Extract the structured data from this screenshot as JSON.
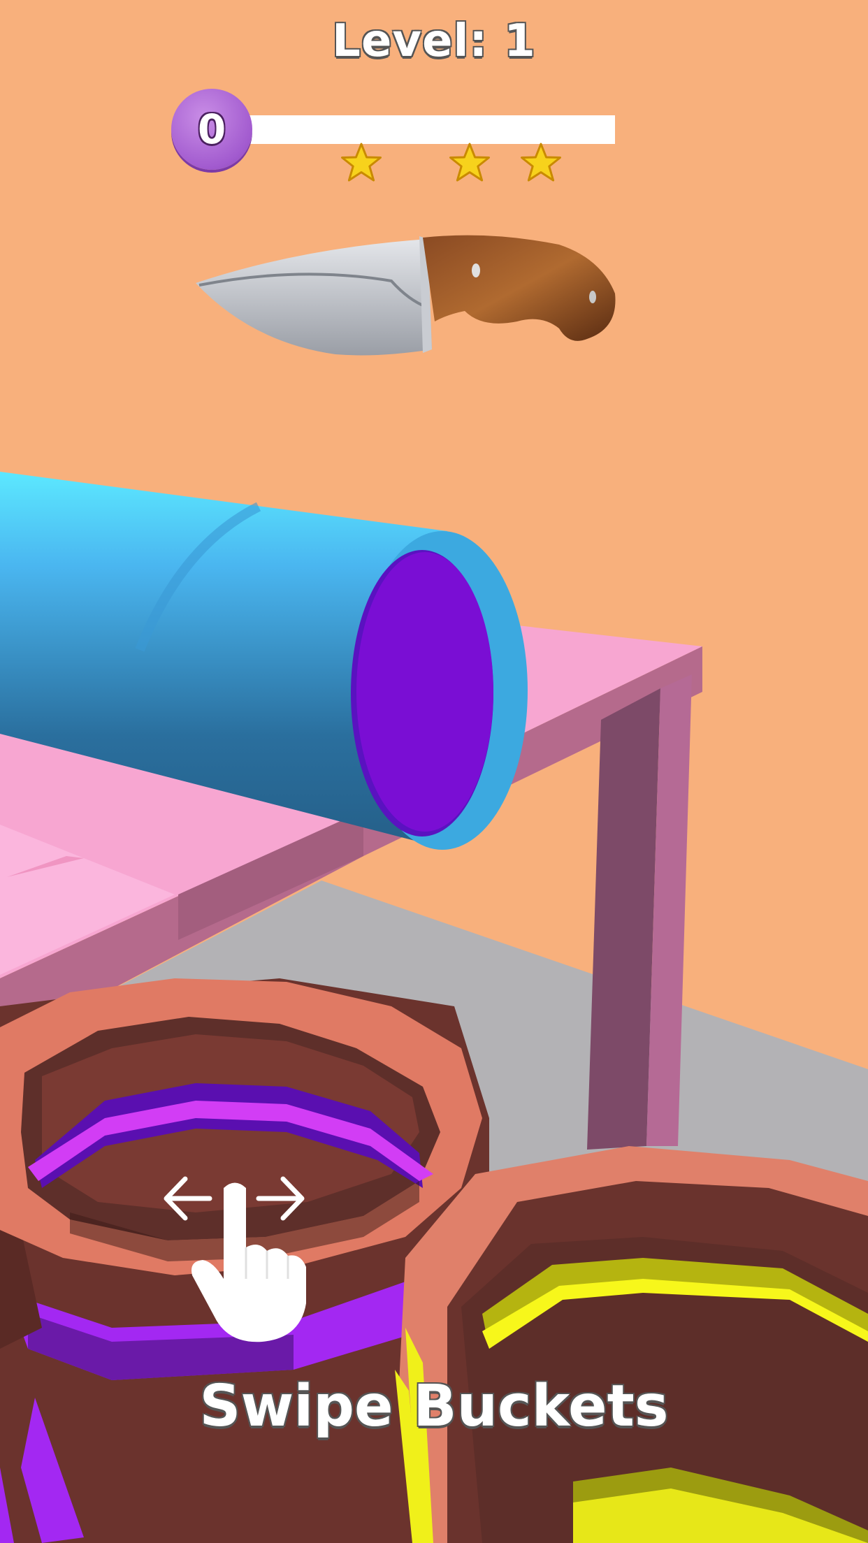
{
  "hud": {
    "level_label": "Level: 1",
    "score": "0",
    "progress_fraction": 0,
    "stars_count": 3
  },
  "hint": {
    "label": "Swipe Buckets",
    "icon": "swipe-hand-icon"
  },
  "scene": {
    "background_color": "#f8b07c",
    "floor_color": "#b3b2b5",
    "table_color": "#f7a6d1",
    "cylinder_color": "#3fb3ec",
    "cylinder_cap_color": "#7a0ed4",
    "bucket_purple_band": "#a328f2",
    "bucket_yellow_band": "#f0f01a",
    "knife_icon": "knife-icon"
  }
}
